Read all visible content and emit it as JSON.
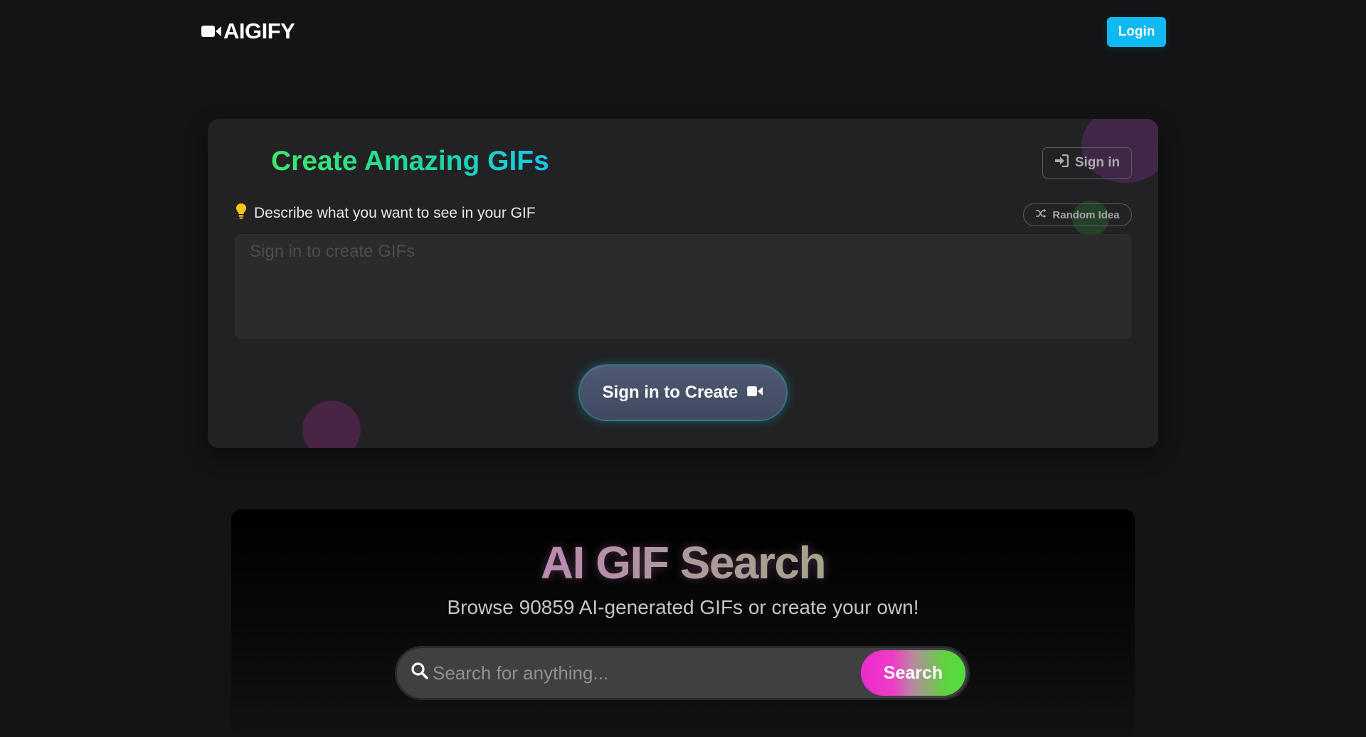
{
  "header": {
    "logo_text": "AIGIFY",
    "login_label": "Login"
  },
  "create": {
    "title": "Create Amazing GIFs",
    "signin_label": "Sign in",
    "prompt_label": "Describe what you want to see in your GIF",
    "random_idea_label": "Random Idea",
    "prompt_placeholder": "Sign in to create GIFs",
    "create_button_label": "Sign in to Create"
  },
  "search": {
    "title": "AI GIF Search",
    "subtitle": "Browse 90859 AI-generated GIFs or create your own!",
    "placeholder": "Search for anything...",
    "button_label": "Search"
  },
  "colors": {
    "accent_login": "#0fb9f2",
    "title_gradient_start": "#3ee86a",
    "title_gradient_end": "#16c6f0",
    "search_button_start": "#ec2bd0",
    "search_button_end": "#4fe03a"
  },
  "icons": {
    "logo": "video-camera-icon",
    "signin": "sign-in-icon",
    "prompt": "lightbulb-icon",
    "random": "shuffle-icon",
    "create": "video-camera-icon",
    "search": "search-icon"
  }
}
